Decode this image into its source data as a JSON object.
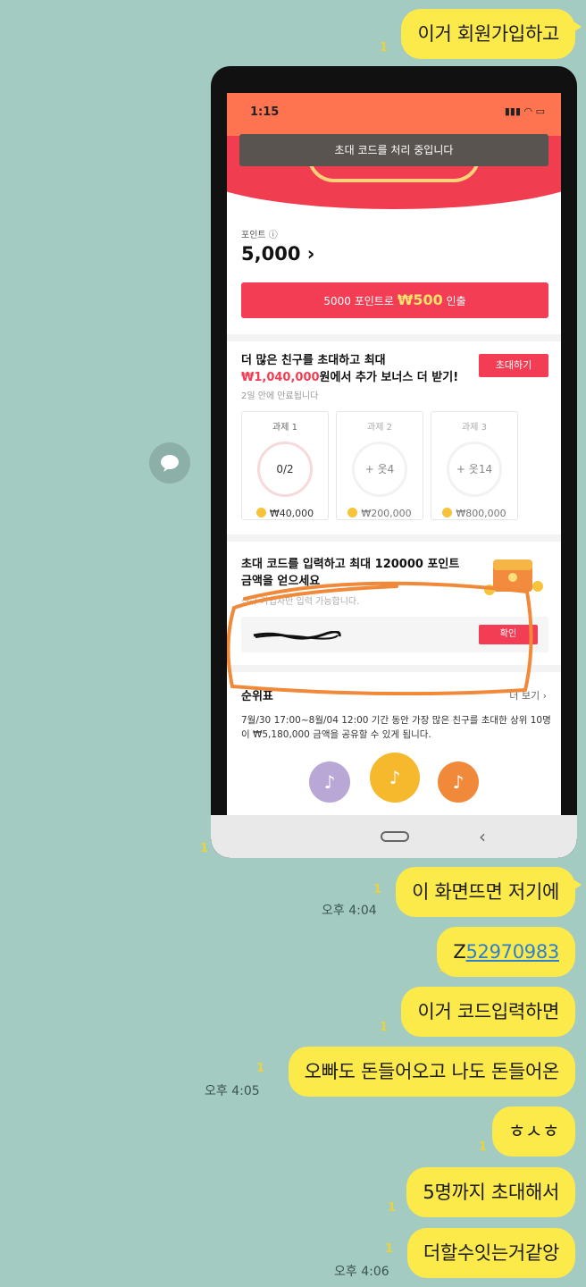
{
  "chat": {
    "messages": [
      {
        "text": "이거 회원가입하고",
        "unread": "1"
      },
      {
        "text": "이 화면뜨면 저기에",
        "unread": "1",
        "time": "오후 4:04"
      },
      {
        "prefix": "Z",
        "link": "52970983",
        "unread": "1"
      },
      {
        "text": "이거 코드입력하면",
        "unread": "1"
      },
      {
        "text": "오빠도 돈들어오고 나도 돈들어온",
        "unread": "1",
        "time": "오후 4:05"
      },
      {
        "text": "ㅎㅅㅎ",
        "unread": "1"
      },
      {
        "text": "5명까지 초대해서",
        "unread": "1"
      },
      {
        "text": "더할수잇는거같앙",
        "unread": "1",
        "time": "오후 4:06"
      }
    ],
    "image_unread": "1"
  },
  "screenshot": {
    "status_time": "1:15",
    "status_icons": "▮▮▮ ◠ ▭",
    "toast": "초대 코드를 처리 중입니다",
    "points_label": "포인트 ⓘ",
    "points_value": "5,000 ›",
    "withdraw_prefix": "5000 포인트로 ",
    "withdraw_amount": "₩500",
    "withdraw_suffix": " 인출",
    "invite_title_1": "더 많은 친구를 초대하고 최대",
    "invite_amount": "₩1,040,000",
    "invite_title_2": "원에서 추가 보너스 더 받기!",
    "expire": "2일 안에 만료됩니다",
    "invite_button": "초대하기",
    "tasks": [
      {
        "name": "과제 1",
        "progress": "0/2",
        "reward": "₩40,000"
      },
      {
        "name": "과제 2",
        "progress": "+ 옷4",
        "reward": "₩200,000"
      },
      {
        "name": "과제 3",
        "progress": "+ 옷14",
        "reward": "₩800,000"
      }
    ],
    "code_title": "초대 코드를 입력하고 최대 120000 포인트 금액을 얻으세요",
    "code_sub": "신규 가입자만 입력 가능합니다.",
    "confirm_button": "확인",
    "rank_title": "순위표",
    "more": "더 보기 ›",
    "rank_desc": "7월/30 17:00~8월/04 12:00 기간 동안 가장 많은 친구를 초대한 상위 10명이 ₩5,180,000 금액을 공유할 수 있게 됩니다."
  },
  "colors": {
    "background": "#a4cbc2",
    "bubble": "#fcea4a",
    "accent_red": "#f23d54",
    "header_orange": "#ff7450",
    "annotation": "#f08a3a"
  },
  "icons": {
    "side": "chat-bubble-icon",
    "medal": "tiktok-note-icon",
    "nav_back": "chevron-left-icon"
  }
}
